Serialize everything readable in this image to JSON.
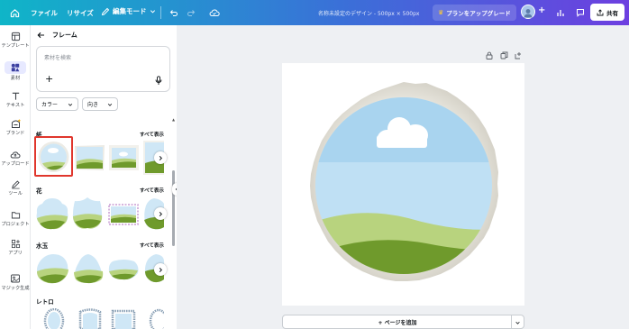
{
  "topbar": {
    "file": "ファイル",
    "resize": "リサイズ",
    "edit_mode": "編集モード",
    "doc_title": "名称未設定のデザイン - 500px × 500px",
    "upgrade": "プランをアップグレード",
    "share": "共有"
  },
  "rail": [
    {
      "label": "テンプレート",
      "icon": "template-icon"
    },
    {
      "label": "素材",
      "icon": "elements-icon"
    },
    {
      "label": "テキスト",
      "icon": "text-icon"
    },
    {
      "label": "ブランド",
      "icon": "brand-icon"
    },
    {
      "label": "アップロード",
      "icon": "upload-icon"
    },
    {
      "label": "ツール",
      "icon": "draw-icon"
    },
    {
      "label": "プロジェクト",
      "icon": "folder-icon"
    },
    {
      "label": "アプリ",
      "icon": "apps-icon"
    },
    {
      "label": "マジック生成",
      "icon": "magic-icon"
    }
  ],
  "panel": {
    "title": "フレーム",
    "search_placeholder": "素材を検索",
    "filter_color": "カラー",
    "filter_orientation": "向き",
    "sections": [
      {
        "title": "紙",
        "see_all": "すべて表示"
      },
      {
        "title": "花",
        "see_all": "すべて表示"
      },
      {
        "title": "水玉",
        "see_all": "すべて表示"
      },
      {
        "title": "レトロ",
        "see_all": ""
      }
    ]
  },
  "canvas": {
    "add_page": "+ ページを追加"
  },
  "colors": {
    "selection": "#e0362c",
    "sky": "#bfe0f4",
    "grass_light": "#b8d37e",
    "grass_dark": "#6f9a2c"
  }
}
